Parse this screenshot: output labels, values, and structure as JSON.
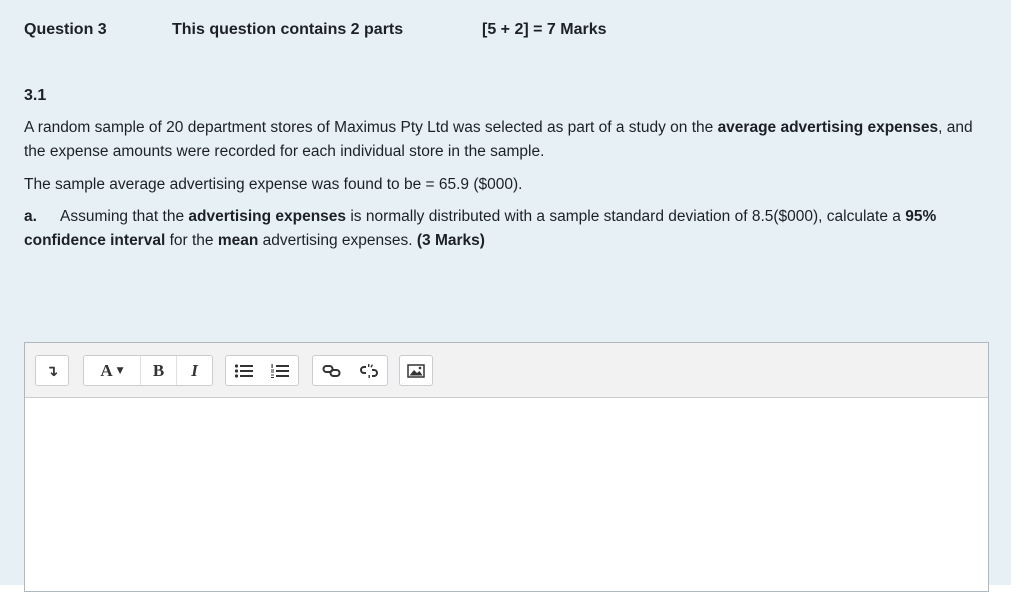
{
  "header": {
    "question": "Question 3",
    "parts": "This question contains 2 parts",
    "marks": "[5 + 2] = 7 Marks"
  },
  "section": "3.1",
  "paragraph1": {
    "t1": "A random sample of 20 department stores of Maximus Pty Ltd was selected as part of a study on the ",
    "b1": "average advertising expenses",
    "t2": ", and the expense amounts were recorded for each individual store in the sample."
  },
  "paragraph2": "The sample average advertising expense was found to be = 65.9 ($000).",
  "paragraph3": {
    "label": "a.",
    "t1": "Assuming that the ",
    "b1": "advertising expenses",
    "t2": " is normally distributed with a sample standard deviation of 8.5($000), calculate a ",
    "b2": "95% confidence interval",
    "t3": " for the ",
    "b3": "mean",
    "t4": " advertising expenses. ",
    "b4": "(3 Marks)"
  },
  "toolbar": {
    "toggle": "↴",
    "font": "A",
    "bold": "B",
    "italic": "I",
    "icons": [
      "expand-toolbar-icon",
      "font-style-icon",
      "bold-icon",
      "italic-icon",
      "unordered-list-icon",
      "ordered-list-icon",
      "link-icon",
      "unlink-icon",
      "image-icon"
    ]
  },
  "editor": {
    "content": ""
  }
}
